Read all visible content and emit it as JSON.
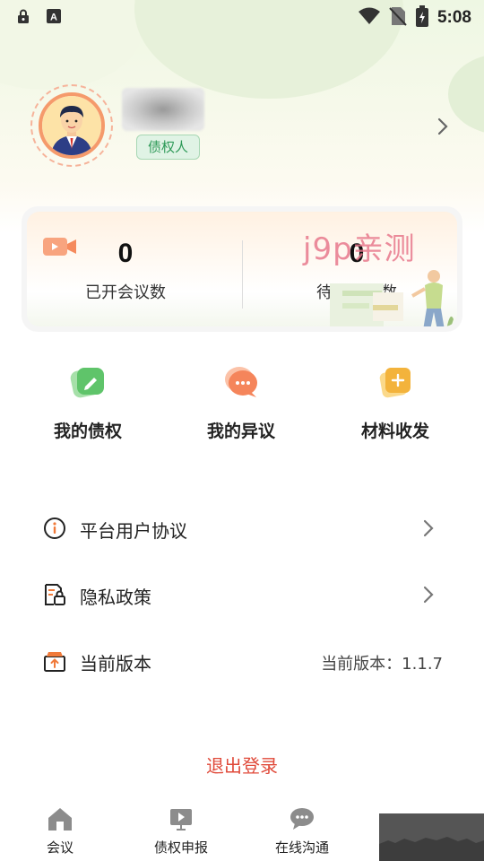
{
  "status_bar": {
    "time": "5:08",
    "left_icons": [
      "lock-icon",
      "text-a-icon"
    ],
    "right_icons": [
      "wifi-icon",
      "no-sim-icon",
      "battery-icon"
    ]
  },
  "profile": {
    "role_badge": "债权人",
    "name_blurred": true,
    "accent_color": "#f59a6b"
  },
  "stats": [
    {
      "value": "0",
      "label": "已开会议数"
    },
    {
      "value": "0",
      "label": "待开会议数"
    }
  ],
  "watermark": "j9p亲测",
  "quick_actions": [
    {
      "label": "我的债权",
      "icon": "edit-icon",
      "color": "#5fc46a"
    },
    {
      "label": "我的异议",
      "icon": "chat-icon",
      "color": "#f5855b"
    },
    {
      "label": "材料收发",
      "icon": "add-doc-icon",
      "color": "#f3b33c"
    }
  ],
  "menu": [
    {
      "label": "平台用户协议",
      "icon": "info-icon"
    },
    {
      "label": "隐私政策",
      "icon": "privacy-icon"
    },
    {
      "label": "当前版本",
      "icon": "version-icon",
      "value": "当前版本：1.1.7"
    }
  ],
  "logout_label": "退出登录",
  "logout_color": "#e04a3a",
  "bottom_nav": [
    {
      "label": "会议",
      "icon": "home-icon"
    },
    {
      "label": "债权申报",
      "icon": "presentation-icon"
    },
    {
      "label": "在线沟通",
      "icon": "chat-bubble-icon"
    }
  ]
}
